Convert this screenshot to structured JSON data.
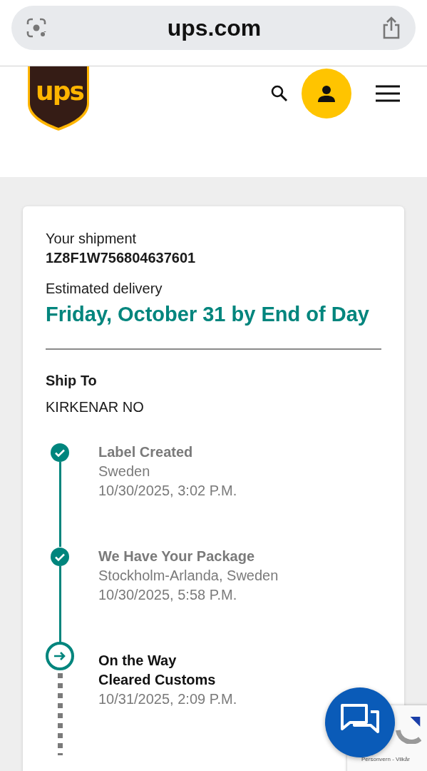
{
  "browser": {
    "address": "ups.com"
  },
  "header": {
    "logo_text": "ups"
  },
  "shipment": {
    "label": "Your shipment",
    "tracking_number": "1Z8F1W756804637601",
    "delivery_label": "Estimated delivery",
    "delivery_date": "Friday, October 31 by End of Day",
    "ship_to_label": "Ship To",
    "ship_to": "KIRKENAR NO"
  },
  "timeline": [
    {
      "kind": "done",
      "status": "Label Created",
      "location": "Sweden",
      "time": "10/30/2025, 3:02 P.M."
    },
    {
      "kind": "done",
      "status": "We Have Your Package",
      "location": "Stockholm-Arlanda, Sweden",
      "time": "10/30/2025, 5:58 P.M."
    },
    {
      "kind": "current",
      "status": "On the Way",
      "detail": "Cleared Customs",
      "time": "10/31/2025, 2:09 P.M."
    }
  ],
  "recaptcha": {
    "links": "Personvern - Vilkår"
  }
}
